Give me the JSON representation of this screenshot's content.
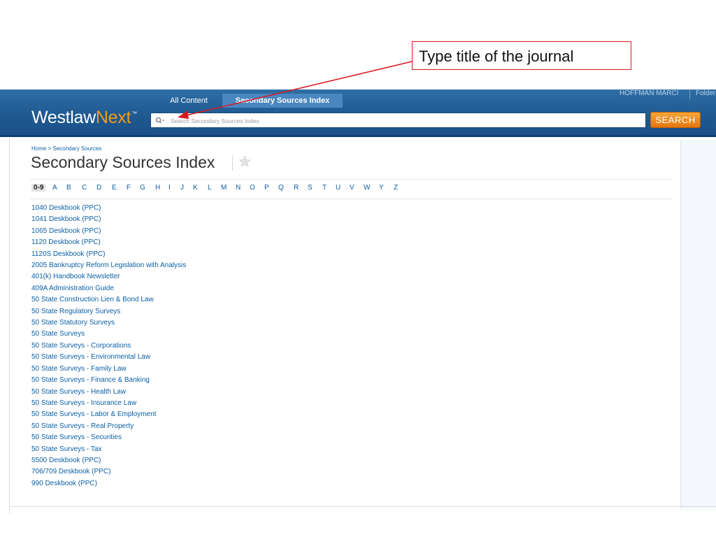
{
  "annotation": {
    "text": "Type title of the journal"
  },
  "header": {
    "logo_part1": "Westlaw",
    "logo_part2": "Next",
    "logo_tm": "™",
    "tabs": [
      {
        "label": "All Content"
      },
      {
        "label": "Secondary Sources Index"
      }
    ],
    "user_name": "HOFFMAN MARCI",
    "user_folder": "Folder",
    "search": {
      "placeholder": "Search Secondary Sources Index",
      "value": ""
    },
    "search_button": "SEARCH"
  },
  "breadcrumb": "Home > Secondary Sources",
  "page_title": "Secondary Sources Index",
  "alphabet": [
    "0-9",
    "A",
    "B",
    "C",
    "D",
    "E",
    "F",
    "G",
    "H",
    "I",
    "J",
    "K",
    "L",
    "M",
    "N",
    "O",
    "P",
    "Q",
    "R",
    "S",
    "T",
    "U",
    "V",
    "W",
    "Y",
    "Z"
  ],
  "active_letter": "0-9",
  "sources": [
    "1040 Deskbook (PPC)",
    "1041 Deskbook (PPC)",
    "1065 Deskbook (PPC)",
    "1120 Deskbook (PPC)",
    "1120S Deskbook (PPC)",
    "2005 Bankruptcy Reform Legislation with Analysis",
    "401(k) Handbook Newsletter",
    "409A Administration Guide",
    "50 State Construction Lien & Bond Law",
    "50 State Regulatory Surveys",
    "50 State Statutory Surveys",
    "50 State Surveys",
    "50 State Surveys - Corporations",
    "50 State Surveys - Environmental Law",
    "50 State Surveys - Family Law",
    "50 State Surveys - Finance & Banking",
    "50 State Surveys - Health Law",
    "50 State Surveys - Insurance Law",
    "50 State Surveys - Labor & Employment",
    "50 State Surveys - Real Property",
    "50 State Surveys - Securities",
    "50 State Surveys - Tax",
    "5500 Deskbook (PPC)",
    "706/709 Deskbook (PPC)",
    "990 Deskbook (PPC)"
  ],
  "colors": {
    "header_blue": "#1f5a91",
    "active_tab": "#4a86c0",
    "logo_orange": "#f39a1f",
    "search_button": "#f08a1e",
    "link_blue": "#0b5fa5",
    "annotation_red": "#d9181f"
  }
}
